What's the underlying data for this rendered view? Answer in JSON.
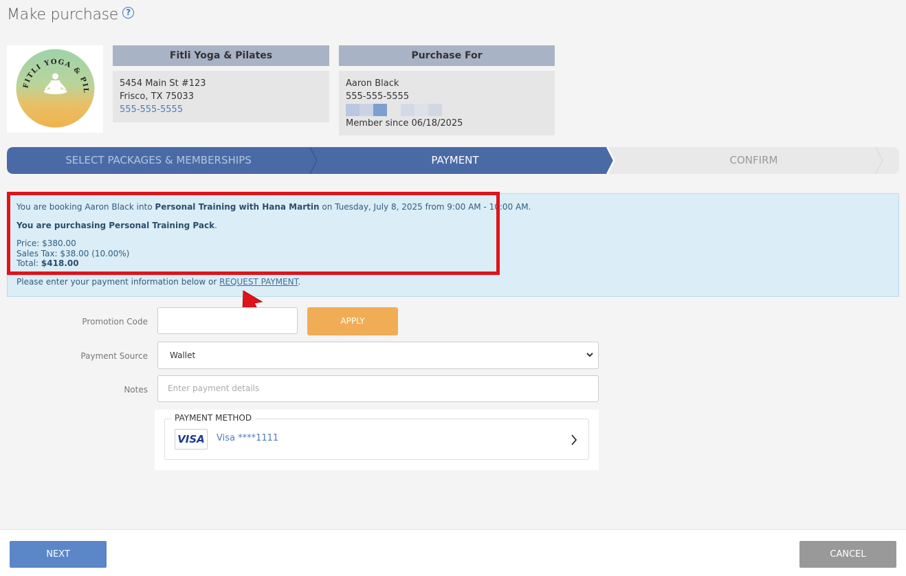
{
  "page": {
    "title": "Make purchase"
  },
  "business": {
    "logo_text": "FITLI YOGA & PILATES",
    "name": "Fitli Yoga & Pilates",
    "address1": "5454 Main St #123",
    "address2": "Frisco, TX 75033",
    "phone": "555-555-5555"
  },
  "purchase_for": {
    "header": "Purchase For",
    "name": "Aaron Black",
    "phone": "555-555-5555",
    "member_since": "Member since 06/18/2025"
  },
  "steps": [
    {
      "label": "SELECT PACKAGES & MEMBERSHIPS",
      "state": "completed"
    },
    {
      "label": "PAYMENT",
      "state": "active"
    },
    {
      "label": "CONFIRM",
      "state": "pending"
    }
  ],
  "booking": {
    "line_prefix": "You are booking Aaron Black into ",
    "class_name": "Personal Training with Hana Martin",
    "line_suffix": " on Tuesday, July 8, 2025 from 9:00 AM - 10:00 AM.",
    "purchasing": "You are purchasing Personal Training Pack",
    "price": "Price: $380.00",
    "tax": "Sales Tax: $38.00 (10.00%)",
    "total_label": "Total: ",
    "total_value": "$418.00",
    "payment_prompt": "Please enter your payment information below or ",
    "request_link": "REQUEST PAYMENT"
  },
  "form": {
    "promo_label": "Promotion Code",
    "promo_value": "",
    "apply_label": "APPLY",
    "source_label": "Payment Source",
    "source_value": "Wallet",
    "notes_label": "Notes",
    "notes_placeholder": "Enter payment details"
  },
  "payment_method": {
    "legend": "PAYMENT METHOD",
    "brand": "VISA",
    "card": "Visa ****1111"
  },
  "footer": {
    "next": "NEXT",
    "cancel": "CANCEL"
  },
  "colors": {
    "accent": "#4a6aa5",
    "apply": "#f0ad56",
    "highlight": "#e0131a",
    "cancel": "#999999",
    "next": "#5b86c7"
  }
}
